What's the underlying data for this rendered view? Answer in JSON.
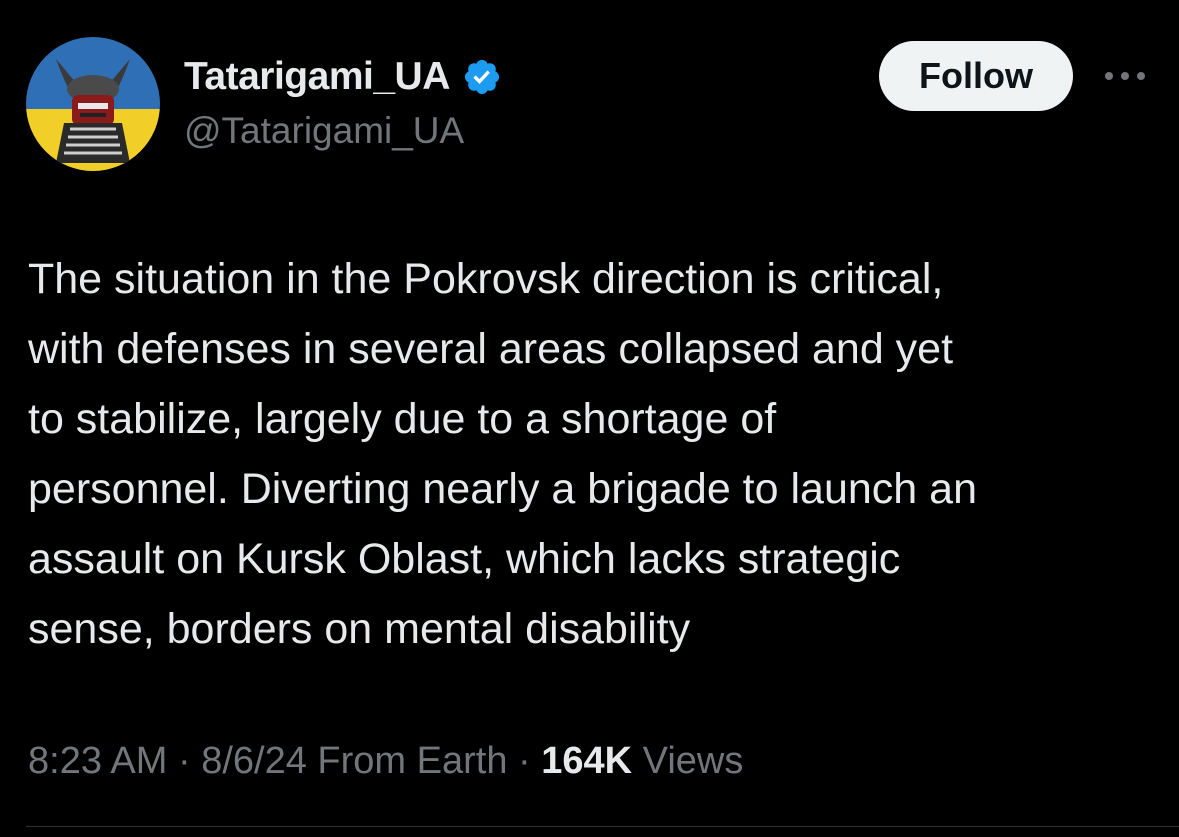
{
  "author": {
    "display_name": "Tatarigami_UA",
    "handle": "@Tatarigami_UA",
    "verified_icon": "verified-badge-icon",
    "avatar_colors": {
      "top": "#2f6fb5",
      "bottom": "#f2cf28"
    }
  },
  "actions": {
    "follow_label": "Follow",
    "more_icon": "more-dots-icon"
  },
  "tweet": {
    "text": "The situation in the Pokrovsk direction is critical,\nwith defenses in several areas collapsed and yet\nto stabilize, largely due to a shortage of\npersonnel. Diverting nearly a brigade to launch an\nassault on Kursk Oblast, which lacks strategic\nsense, borders on mental disability"
  },
  "meta": {
    "time": "8:23 AM",
    "date": "8/6/24",
    "source": "From Earth",
    "views_count": "164K",
    "views_label": "Views"
  },
  "colors": {
    "background": "#000000",
    "text_primary": "#e7e9ea",
    "text_secondary": "#71767b",
    "verified_blue": "#1d9bf0",
    "follow_bg": "#eff3f4"
  }
}
